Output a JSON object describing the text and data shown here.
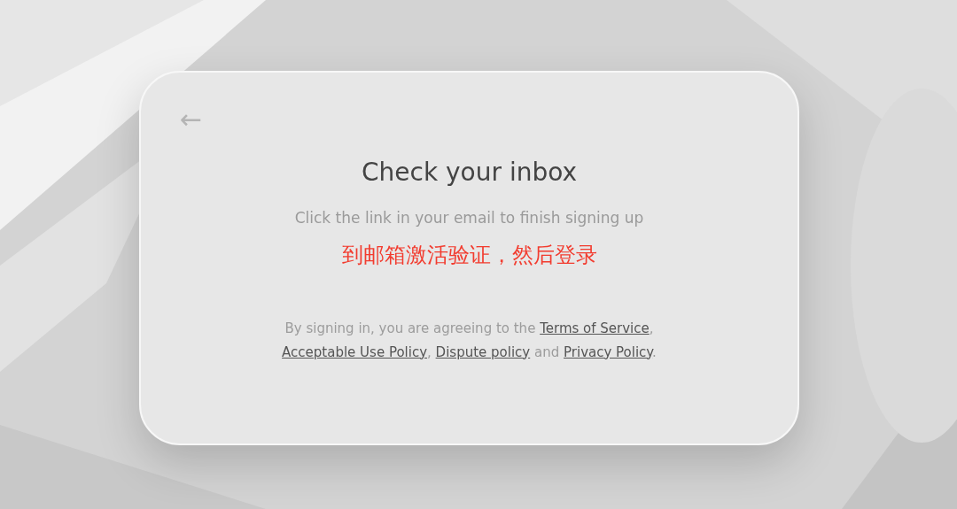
{
  "card": {
    "back_button": {
      "label": "←"
    },
    "title": "Check your inbox",
    "subtitle": "Click the link in your email to finish signing up",
    "note": "到邮箱激活验证，然后登录",
    "terms": [
      {
        "kind": "text",
        "text": "By signing in, you are agreeing to the"
      },
      {
        "kind": "link",
        "text": "Terms of Service"
      },
      {
        "kind": "text",
        "text": ","
      },
      {
        "kind": "link",
        "text": "Acceptable Use Policy"
      },
      {
        "kind": "text",
        "text": ","
      },
      {
        "kind": "link",
        "text": "Dispute policy"
      },
      {
        "kind": "text",
        "text": "and"
      },
      {
        "kind": "link",
        "text": "Privacy Policy"
      },
      {
        "kind": "text",
        "text": "."
      }
    ]
  }
}
